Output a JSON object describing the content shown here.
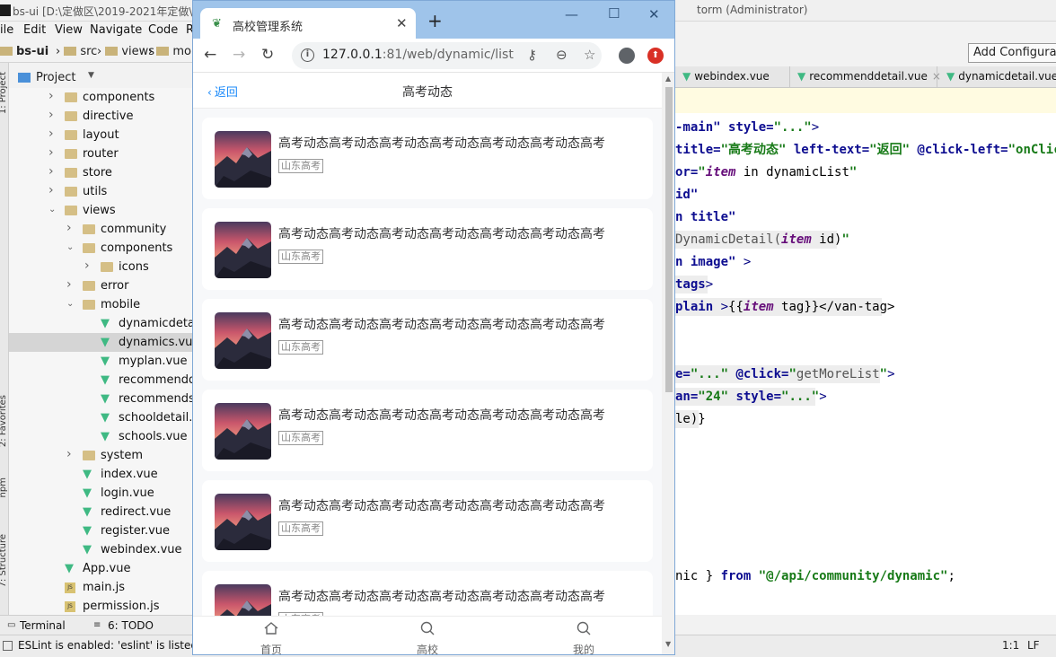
{
  "ide": {
    "title_left": "bs-ui [D:\\定做区\\2019-2021年定做\\",
    "title_right": "torm (Administrator)",
    "menu": [
      "ile",
      "Edit",
      "View",
      "Navigate",
      "Code",
      "R"
    ],
    "nav_path": [
      "bs-ui",
      "src",
      "views",
      "mol"
    ],
    "project_label": "Project",
    "side_tabs": [
      "1: Project",
      "2: Favorites",
      "npm",
      "7: Structure"
    ],
    "tree": [
      {
        "name": "components",
        "type": "folder",
        "level": 1,
        "expanded": false
      },
      {
        "name": "directive",
        "type": "folder",
        "level": 1,
        "expanded": false
      },
      {
        "name": "layout",
        "type": "folder",
        "level": 1,
        "expanded": false
      },
      {
        "name": "router",
        "type": "folder",
        "level": 1,
        "expanded": false
      },
      {
        "name": "store",
        "type": "folder",
        "level": 1,
        "expanded": false
      },
      {
        "name": "utils",
        "type": "folder",
        "level": 1,
        "expanded": false
      },
      {
        "name": "views",
        "type": "folder",
        "level": 1,
        "expanded": true
      },
      {
        "name": "community",
        "type": "folder",
        "level": 2,
        "expanded": false
      },
      {
        "name": "components",
        "type": "folder",
        "level": 2,
        "expanded": true
      },
      {
        "name": "icons",
        "type": "folder",
        "level": 3,
        "expanded": false
      },
      {
        "name": "error",
        "type": "folder",
        "level": 2,
        "expanded": false
      },
      {
        "name": "mobile",
        "type": "folder",
        "level": 2,
        "expanded": true
      },
      {
        "name": "dynamicdetail.",
        "type": "vue",
        "level": 3
      },
      {
        "name": "dynamics.vue",
        "type": "vue",
        "level": 3,
        "selected": true
      },
      {
        "name": "myplan.vue",
        "type": "vue",
        "level": 3
      },
      {
        "name": "recommendde",
        "type": "vue",
        "level": 3
      },
      {
        "name": "recommends.v",
        "type": "vue",
        "level": 3
      },
      {
        "name": "schooldetail.vu",
        "type": "vue",
        "level": 3
      },
      {
        "name": "schools.vue",
        "type": "vue",
        "level": 3
      },
      {
        "name": "system",
        "type": "folder",
        "level": 2,
        "expanded": false
      },
      {
        "name": "index.vue",
        "type": "vue",
        "level": 2
      },
      {
        "name": "login.vue",
        "type": "vue",
        "level": 2
      },
      {
        "name": "redirect.vue",
        "type": "vue",
        "level": 2
      },
      {
        "name": "register.vue",
        "type": "vue",
        "level": 2
      },
      {
        "name": "webindex.vue",
        "type": "vue",
        "level": 2
      },
      {
        "name": "App.vue",
        "type": "vue",
        "level": 1
      },
      {
        "name": "main.js",
        "type": "js",
        "level": 1
      },
      {
        "name": "permission.js",
        "type": "js",
        "level": 1
      }
    ],
    "bottom_tabs": [
      "Terminal",
      "6: TODO"
    ],
    "status_message": "ESLint is enabled: 'eslint' is listed",
    "cursor_pos": "1:1",
    "line_ending": "LF",
    "add_config_label": "Add Configurati",
    "editor_tabs": [
      "webindex.vue",
      "recommenddetail.vue",
      "dynamicdetail.vue"
    ]
  },
  "browser": {
    "tab_title": "高校管理系统",
    "url_host": "127.0.0.1",
    "url_path": ":81/web/dynamic/list",
    "navbar_back": "返回",
    "navbar_title": "高考动态",
    "items": [
      {
        "title": "高考动态高考动态高考动态高考动态高考动态高考动态高考",
        "tag": "山东高考"
      },
      {
        "title": "高考动态高考动态高考动态高考动态高考动态高考动态高考",
        "tag": "山东高考"
      },
      {
        "title": "高考动态高考动态高考动态高考动态高考动态高考动态高考",
        "tag": "山东高考"
      },
      {
        "title": "高考动态高考动态高考动态高考动态高考动态高考动态高考",
        "tag": "山东高考"
      },
      {
        "title": "高考动态高考动态高考动态高考动态高考动态高考动态高考",
        "tag": "山东高考"
      },
      {
        "title": "高考动态高考动态高考动态高考动态高考动态高考动态高考",
        "tag": "山东高考"
      }
    ],
    "tabbar": [
      {
        "label": "首页",
        "icon": "home-icon"
      },
      {
        "label": "高校",
        "icon": "search-icon"
      },
      {
        "label": "我的",
        "icon": "search-icon"
      }
    ]
  },
  "colors": {
    "accent_blue": "#1989fa",
    "vue_green": "#3fb983",
    "browser_frame": "#9fc4ea"
  }
}
